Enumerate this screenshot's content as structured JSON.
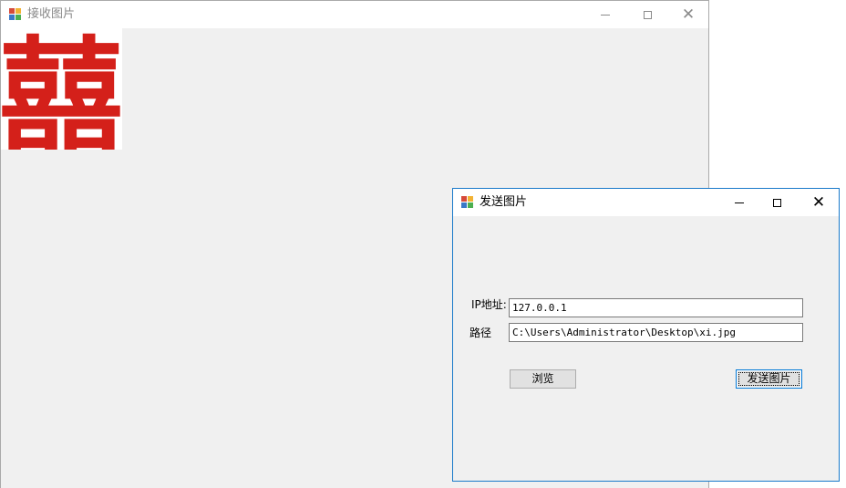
{
  "receive_window": {
    "title": "接收图片",
    "controls": {
      "minimize": "—",
      "maximize": "□",
      "close": "✕"
    },
    "image_char": "囍",
    "image_color": "#d4201a"
  },
  "send_window": {
    "title": "发送图片",
    "controls": {
      "minimize": "—",
      "maximize": "□",
      "close": "✕"
    },
    "ip_label": "IP地址:",
    "ip_value": "127.0.0.1",
    "path_label": "路径",
    "path_value": "C:\\Users\\Administrator\\Desktop\\xi.jpg",
    "browse_label": "浏览",
    "send_label": "发送图片"
  }
}
